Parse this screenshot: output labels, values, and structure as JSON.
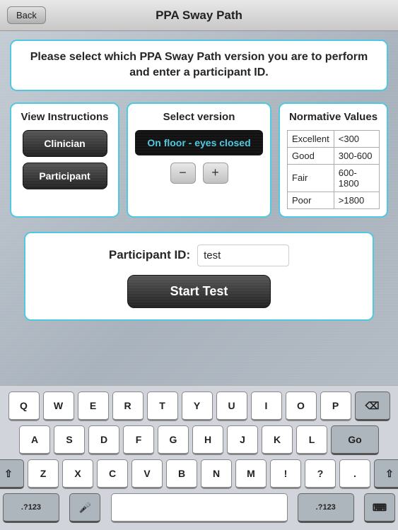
{
  "topBar": {
    "backLabel": "Back",
    "title": "PPA Sway Path"
  },
  "instructionBanner": {
    "text": "Please select which PPA Sway Path version you are to perform and enter a participant ID."
  },
  "viewInstructions": {
    "title": "View Instructions",
    "clinicianLabel": "Clinician",
    "participantLabel": "Participant"
  },
  "selectVersion": {
    "title": "Select version",
    "currentVersion": "On floor - eyes closed",
    "decrementLabel": "−",
    "incrementLabel": "+"
  },
  "normativeValues": {
    "title": "Normative Values",
    "rows": [
      {
        "label": "Excellent",
        "value": "<300"
      },
      {
        "label": "Good",
        "value": "300-600"
      },
      {
        "label": "Fair",
        "value": "600-1800"
      },
      {
        "label": "Poor",
        "value": ">1800"
      }
    ]
  },
  "participantSection": {
    "idLabel": "Participant ID:",
    "idValue": "test",
    "idPlaceholder": "test",
    "startLabel": "Start Test"
  },
  "keyboard": {
    "rows": [
      [
        "Q",
        "W",
        "E",
        "R",
        "T",
        "Y",
        "U",
        "I",
        "O",
        "P"
      ],
      [
        "A",
        "S",
        "D",
        "F",
        "G",
        "H",
        "J",
        "K",
        "L"
      ],
      [
        "⇧",
        "Z",
        "X",
        "C",
        "V",
        "B",
        "N",
        "M",
        "!",
        "?",
        ".",
        "⇧"
      ]
    ],
    "bottomLeft": ".?123",
    "mic": "🎤",
    "space": "",
    "bottomRight": ".?123",
    "keyboard": "⌨"
  }
}
